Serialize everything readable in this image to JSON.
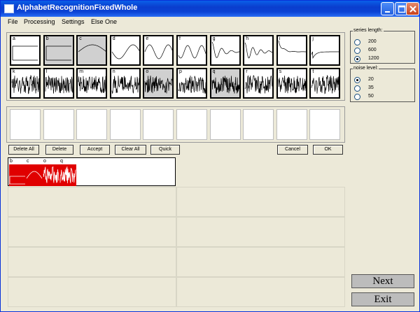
{
  "window": {
    "title": "AlphabetRecognitionFixedWhole"
  },
  "menu": [
    "File",
    "Processing",
    "Settings",
    "Else One"
  ],
  "signals": [
    {
      "label": "a",
      "selected": false,
      "shape": "step"
    },
    {
      "label": "b",
      "selected": true,
      "shape": "step"
    },
    {
      "label": "c",
      "selected": true,
      "shape": "hump"
    },
    {
      "label": "d",
      "selected": false,
      "shape": "sine"
    },
    {
      "label": "e",
      "selected": false,
      "shape": "sine2"
    },
    {
      "label": "f",
      "selected": false,
      "shape": "sine3"
    },
    {
      "label": "g",
      "selected": false,
      "shape": "ring1"
    },
    {
      "label": "h",
      "selected": false,
      "shape": "ring2"
    },
    {
      "label": "i",
      "selected": false,
      "shape": "decay"
    },
    {
      "label": "j",
      "selected": false,
      "shape": "dip"
    },
    {
      "label": "k",
      "selected": false,
      "shape": "noise"
    },
    {
      "label": "l",
      "selected": false,
      "shape": "noise"
    },
    {
      "label": "m",
      "selected": false,
      "shape": "noise"
    },
    {
      "label": "n",
      "selected": false,
      "shape": "noise"
    },
    {
      "label": "o",
      "selected": true,
      "shape": "noise"
    },
    {
      "label": "p",
      "selected": false,
      "shape": "noise"
    },
    {
      "label": "q",
      "selected": true,
      "shape": "noise"
    },
    {
      "label": "r",
      "selected": false,
      "shape": "noise"
    },
    {
      "label": "s",
      "selected": false,
      "shape": "noise"
    },
    {
      "label": "t",
      "selected": false,
      "shape": "noise"
    }
  ],
  "buttons": {
    "delete_all": "Delete All",
    "delete": "Delete",
    "accept": "Accept",
    "clear_all": "Clear All",
    "quick": "Quick",
    "cancel": "Cancel",
    "ok": "OK"
  },
  "results": [
    "b",
    "c",
    "o",
    "q"
  ],
  "series_length": {
    "title": "series length:",
    "options": [
      "200",
      "600",
      "1200"
    ],
    "selected": "1200"
  },
  "noise_level": {
    "title": "noise level:",
    "options": [
      "20",
      "35",
      "50"
    ],
    "selected": "20"
  },
  "next_label": "Next",
  "exit_label": "Exit",
  "colors": {
    "result_fill": "#e00000",
    "selected_tile": "#d0d0d0",
    "titlebar": "#0a3dcd"
  }
}
